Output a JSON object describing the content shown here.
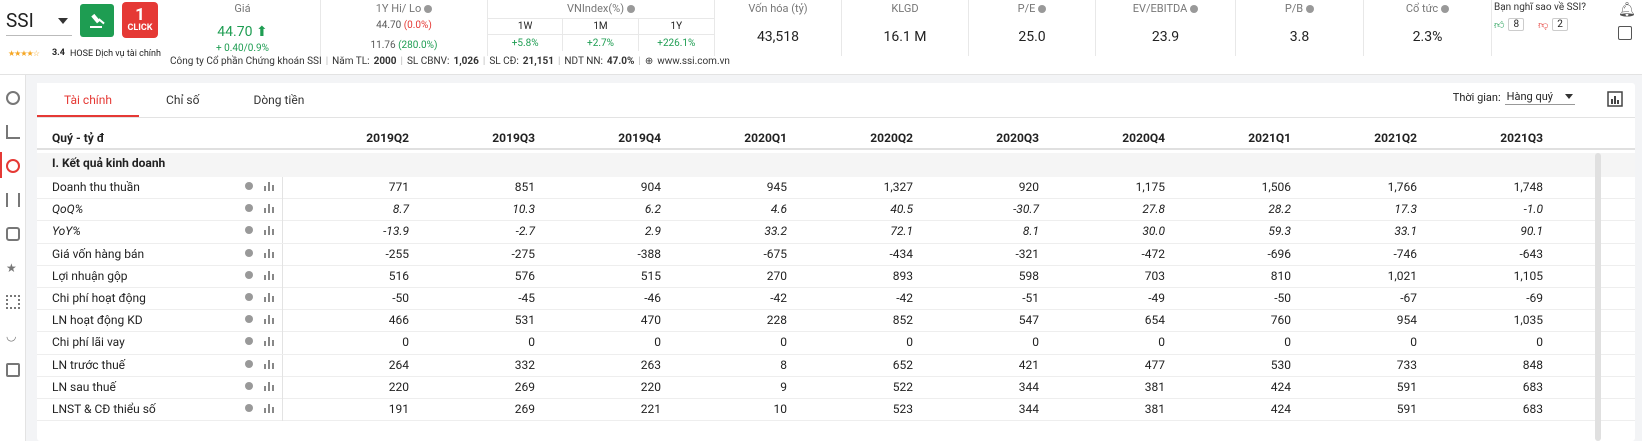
{
  "ticker": {
    "symbol": "SSI",
    "rating": "3.4",
    "exchange": "HOSE",
    "sector": "Dịch vụ tài chính",
    "click_label": "CLICK",
    "click_num": "1"
  },
  "metrics": {
    "price": {
      "label": "Giá",
      "value": "44.70",
      "change": "+ 0.40/0.9%"
    },
    "hilo": {
      "label": "1Y Hi/ Lo",
      "hi": "44.70",
      "hi_pct": "(0.0%)",
      "lo": "11.76",
      "lo_pct": "(280.0%)"
    },
    "vnindex": {
      "label": "VNIndex(%)",
      "cols": [
        "1W",
        "1M",
        "1Y"
      ],
      "vals": [
        "+5.8%",
        "+2.7%",
        "+226.1%"
      ]
    },
    "market_cap": {
      "label": "Vốn hóa (tỷ)",
      "value": "43,518"
    },
    "volume": {
      "label": "KLGD",
      "value": "16.1 M"
    },
    "pe": {
      "label": "P/E",
      "value": "25.0"
    },
    "ev_ebitda": {
      "label": "EV/EBITDA",
      "value": "23.9"
    },
    "pb": {
      "label": "P/B",
      "value": "3.8"
    },
    "dividend": {
      "label": "Cổ tức",
      "value": "2.3%"
    }
  },
  "review": {
    "label": "Bạn nghĩ sao về SSI?",
    "likes": "8",
    "dislikes": "2"
  },
  "info_bar": {
    "company": "Công ty Cổ phần Chứng khoán SSI",
    "founded_label": "Năm TL:",
    "founded": "2000",
    "staff_label": "SL CBNV:",
    "staff": "1,026",
    "shareholders_label": "SL CĐ:",
    "shareholders": "21,151",
    "foreign_label": "NDT NN:",
    "foreign": "47.0%",
    "website": "www.ssi.com.vn"
  },
  "tabs": [
    {
      "label": "Tài chính"
    },
    {
      "label": "Chỉ số"
    },
    {
      "label": "Dòng tiền"
    }
  ],
  "period": {
    "label": "Thời gian:",
    "value": "Hàng quý"
  },
  "table": {
    "unit_label": "Quý - tỷ đ",
    "columns": [
      "2019Q2",
      "2019Q3",
      "2019Q4",
      "2020Q1",
      "2020Q2",
      "2020Q3",
      "2020Q4",
      "2021Q1",
      "2021Q2",
      "2021Q3"
    ],
    "section": "I. Kết quả kinh doanh",
    "rows": [
      {
        "name": "Doanh thu thuần",
        "italic": false,
        "values": [
          "771",
          "851",
          "904",
          "945",
          "1,327",
          "920",
          "1,175",
          "1,506",
          "1,766",
          "1,748"
        ]
      },
      {
        "name": "QoQ%",
        "italic": true,
        "values": [
          "8.7",
          "10.3",
          "6.2",
          "4.6",
          "40.5",
          "-30.7",
          "27.8",
          "28.2",
          "17.3",
          "-1.0"
        ]
      },
      {
        "name": "YoY%",
        "italic": true,
        "values": [
          "-13.9",
          "-2.7",
          "2.9",
          "33.2",
          "72.1",
          "8.1",
          "30.0",
          "59.3",
          "33.1",
          "90.1"
        ]
      },
      {
        "name": "Giá vốn hàng bán",
        "italic": false,
        "values": [
          "-255",
          "-275",
          "-388",
          "-675",
          "-434",
          "-321",
          "-472",
          "-696",
          "-746",
          "-643"
        ]
      },
      {
        "name": "Lợi nhuận gộp",
        "italic": false,
        "values": [
          "516",
          "576",
          "515",
          "270",
          "893",
          "598",
          "703",
          "810",
          "1,021",
          "1,105"
        ]
      },
      {
        "name": "Chi phí hoạt động",
        "italic": false,
        "values": [
          "-50",
          "-45",
          "-46",
          "-42",
          "-42",
          "-51",
          "-49",
          "-50",
          "-67",
          "-69"
        ]
      },
      {
        "name": "LN hoạt động KD",
        "italic": false,
        "values": [
          "466",
          "531",
          "470",
          "228",
          "852",
          "547",
          "654",
          "760",
          "954",
          "1,035"
        ]
      },
      {
        "name": "Chi phí lãi vay",
        "italic": false,
        "values": [
          "0",
          "0",
          "0",
          "0",
          "0",
          "0",
          "0",
          "0",
          "0",
          "0"
        ]
      },
      {
        "name": "LN trước thuế",
        "italic": false,
        "values": [
          "264",
          "332",
          "263",
          "8",
          "652",
          "421",
          "477",
          "530",
          "733",
          "848"
        ]
      },
      {
        "name": "LN sau thuế",
        "italic": false,
        "values": [
          "220",
          "269",
          "220",
          "9",
          "522",
          "344",
          "381",
          "424",
          "591",
          "683"
        ]
      },
      {
        "name": "LNST & CĐ thiểu số",
        "italic": false,
        "values": [
          "191",
          "269",
          "221",
          "10",
          "523",
          "344",
          "381",
          "424",
          "591",
          "683"
        ]
      }
    ]
  }
}
